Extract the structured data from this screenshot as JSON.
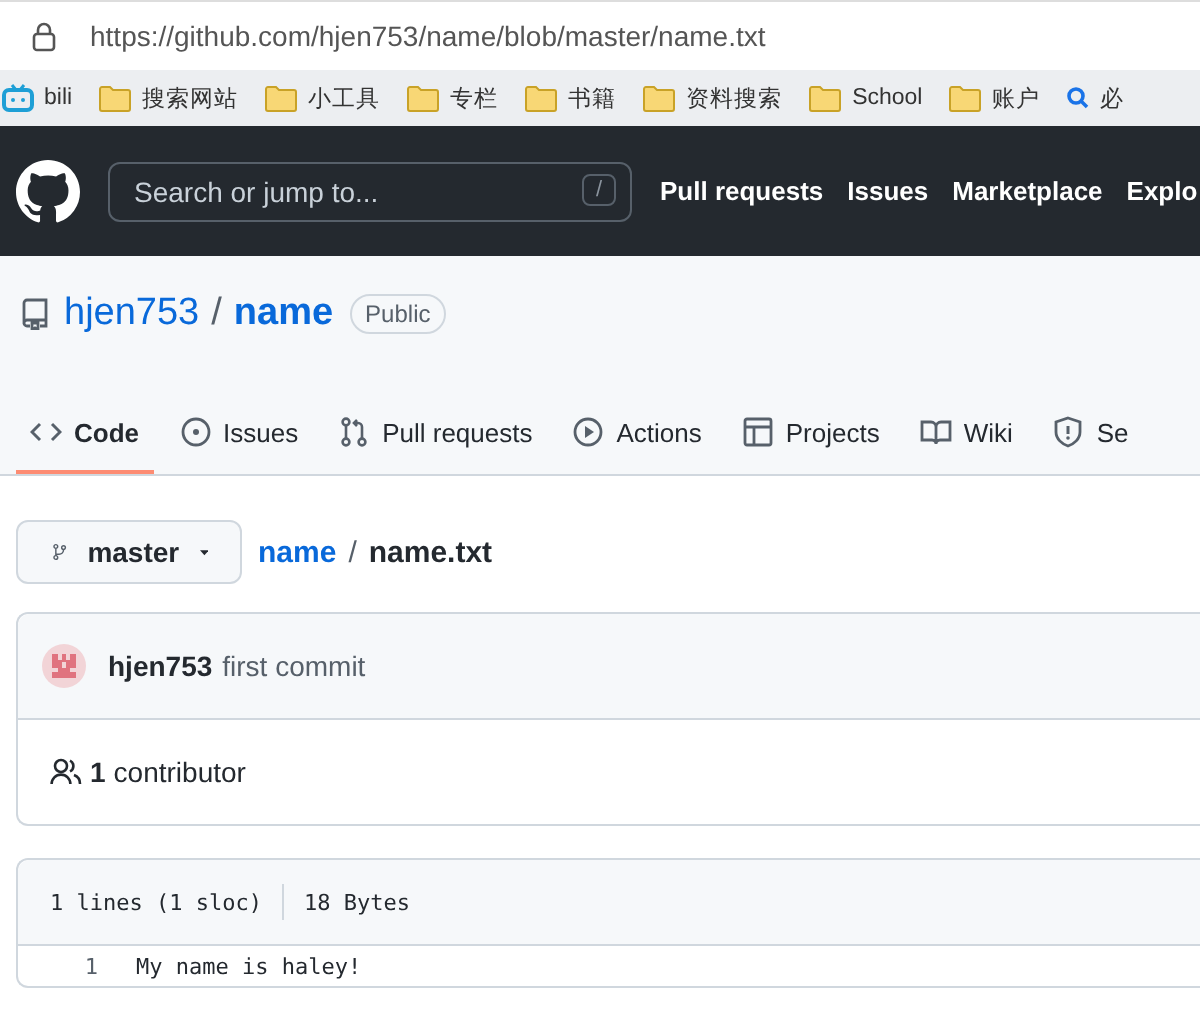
{
  "browser": {
    "url": "https://github.com/hjen753/name/blob/master/name.txt",
    "bookmarks": [
      {
        "kind": "app",
        "label": "bili"
      },
      {
        "kind": "folder",
        "label": "搜索网站"
      },
      {
        "kind": "folder",
        "label": "小工具"
      },
      {
        "kind": "folder",
        "label": "专栏"
      },
      {
        "kind": "folder",
        "label": "书籍"
      },
      {
        "kind": "folder",
        "label": "资料搜索"
      },
      {
        "kind": "folder",
        "label": "School"
      },
      {
        "kind": "folder",
        "label": "账户"
      },
      {
        "kind": "search",
        "label": "必"
      }
    ]
  },
  "header": {
    "search": {
      "placeholder": "Search or jump to...",
      "shortcut": "/"
    },
    "nav": [
      "Pull requests",
      "Issues",
      "Marketplace",
      "Explo"
    ]
  },
  "repo": {
    "owner": "hjen753",
    "separator": "/",
    "name": "name",
    "visibility": "Public",
    "tabs": [
      {
        "kind": "code",
        "label": "Code",
        "selected": true
      },
      {
        "kind": "issues",
        "label": "Issues",
        "selected": false
      },
      {
        "kind": "pulls",
        "label": "Pull requests",
        "selected": false
      },
      {
        "kind": "actions",
        "label": "Actions",
        "selected": false
      },
      {
        "kind": "projects",
        "label": "Projects",
        "selected": false
      },
      {
        "kind": "wiki",
        "label": "Wiki",
        "selected": false
      },
      {
        "kind": "security",
        "label": "Se",
        "selected": false
      }
    ]
  },
  "branch": "master",
  "breadcrumb": {
    "repo": "name",
    "separator": "/",
    "file": "name.txt"
  },
  "commit": {
    "author": "hjen753",
    "message": "first commit"
  },
  "contributors": {
    "count": "1",
    "label": "contributor"
  },
  "file": {
    "lines": "1 lines (1 sloc)",
    "size": "18 Bytes",
    "code": [
      {
        "number": "1",
        "text": "My name is haley!"
      }
    ]
  }
}
